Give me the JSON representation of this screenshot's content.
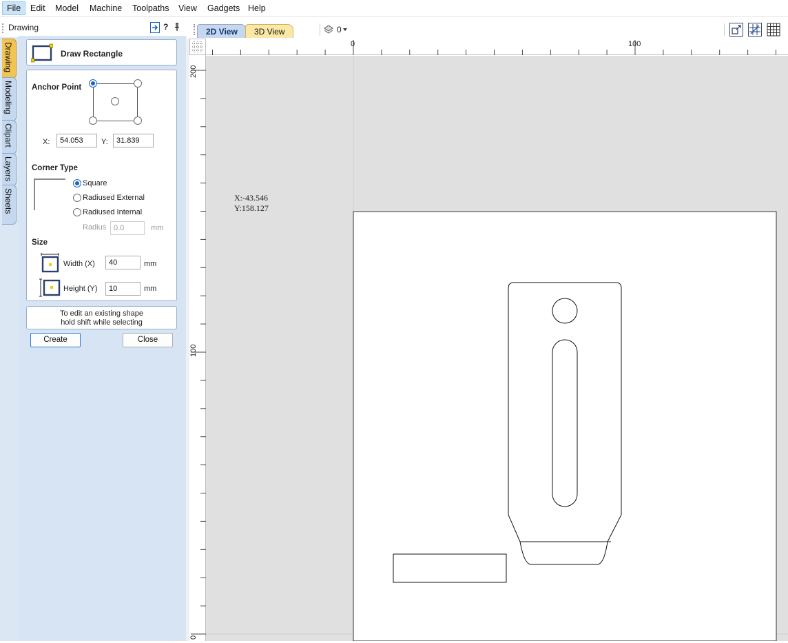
{
  "menubar": {
    "items": [
      "File",
      "Edit",
      "Model",
      "Machine",
      "Toolpaths",
      "View",
      "Gadgets",
      "Help"
    ],
    "active": "File"
  },
  "panel": {
    "title": "Drawing",
    "help_icon_label": "?",
    "side_tabs": [
      "Drawing",
      "Modeling",
      "Clipart",
      "Layers",
      "Sheets"
    ],
    "active_side_tab": "Drawing"
  },
  "draw_rectangle": {
    "title": "Draw Rectangle",
    "anchor": {
      "heading": "Anchor Point",
      "selected": "top-left",
      "x_label": "X:",
      "x_value": "54.053",
      "y_label": "Y:",
      "y_value": "31.839"
    },
    "corner_type": {
      "heading": "Corner Type",
      "options": [
        "Square",
        "Radiused External",
        "Radiused Internal"
      ],
      "selected": "Square",
      "radius_label": "Radius",
      "radius_value": "0.0",
      "radius_unit": "mm"
    },
    "size": {
      "heading": "Size",
      "width_label": "Width (X)",
      "width_value": "40",
      "width_unit": "mm",
      "height_label": "Height (Y)",
      "height_value": "10",
      "height_unit": "mm"
    },
    "hint_line1": "To edit an existing shape",
    "hint_line2": "hold shift while selecting",
    "create_label": "Create",
    "close_label": "Close"
  },
  "view_tabs": {
    "tab_2d": "2D View",
    "tab_3d": "3D View",
    "active": "2D View",
    "layer_label": "0"
  },
  "rulers": {
    "horizontal": [
      "0",
      "100"
    ],
    "vertical": [
      "200",
      "100",
      "0"
    ]
  },
  "cursor_readout": {
    "x": "X:-43.546",
    "y": "Y:158.127"
  },
  "colors": {
    "accent": "#1a63c6",
    "active_tab": "#f2c453",
    "panel_bg": "#d6e4f3",
    "canvas_bg": "#e0e0e0"
  }
}
